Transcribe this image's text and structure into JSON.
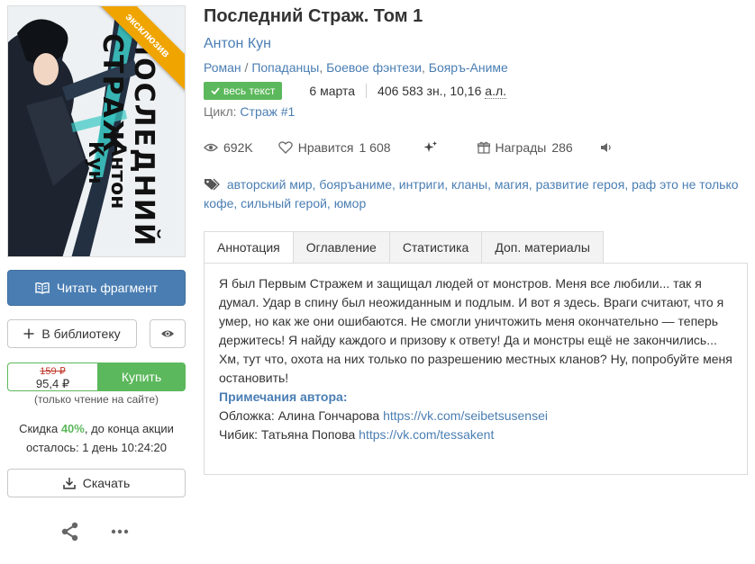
{
  "cover": {
    "ribbon": "эксклюзив",
    "art_title": "ПОСЛЕДНИЙ СТРАЖ",
    "art_author": "Антон Кун"
  },
  "book": {
    "title": "Последний Страж. Том 1",
    "author": "Антон Кун",
    "genres": [
      "Роман",
      "Попаданцы",
      "Боевое фэнтези",
      "Бояръ-Аниме"
    ],
    "genre_separator": "/",
    "badge": "весь текст",
    "date": "6 марта",
    "size_chars": "406 583 зн., 10,16",
    "size_unit": "а.л.",
    "cycle_label": "Цикл:",
    "cycle_name": "Страж #1"
  },
  "stats": {
    "views": "692K",
    "likes_label": "Нравится",
    "likes": "1 608",
    "awards_label": "Награды",
    "awards": "286"
  },
  "tags": [
    "авторский мир",
    "бояръаниме",
    "интриги",
    "кланы",
    "магия",
    "развитие героя",
    "раф это не только кофе",
    "сильный герой",
    "юмор"
  ],
  "tabs": [
    "Аннотация",
    "Оглавление",
    "Статистика",
    "Доп. материалы"
  ],
  "annotation": {
    "text": "Я был Первым Стражем и защищал людей от монстров. Меня все любили... так я думал. Удар в спину был неожиданным и подлым. И вот я здесь. Враги считают, что я умер, но как же они ошибаются. Не смогли уничтожить меня окончательно — теперь держитесь! Я найду каждого и призову к ответу! Да и монстры ещё не закончились... Хм, тут что, охота на них только по разрешению местных кланов? Ну, попробуйте меня остановить!",
    "notes_title": "Примечания автора:",
    "cover_credit_label": "Обложка: Алина Гончарова",
    "cover_credit_link": "https://vk.com/seibetsusensei",
    "chibi_credit_label": "Чибик: Татьяна Попова",
    "chibi_credit_link": "https://vk.com/tessakent"
  },
  "sidebar": {
    "read_fragment": "Читать фрагмент",
    "add_library": "В библиотеку",
    "price_old": "159 ₽",
    "price_new": "95,4 ₽",
    "buy": "Купить",
    "read_only_note": "(только чтение на сайте)",
    "discount_prefix": "Скидка",
    "discount_pct": "40%",
    "discount_suffix": ", до конца акции",
    "discount_remaining": "осталось: 1 день 10:24:20",
    "download": "Скачать"
  },
  "colors": {
    "accent_blue": "#4a7eb3",
    "buy_green": "#5cb85c",
    "ribbon_orange": "#f0a400"
  }
}
